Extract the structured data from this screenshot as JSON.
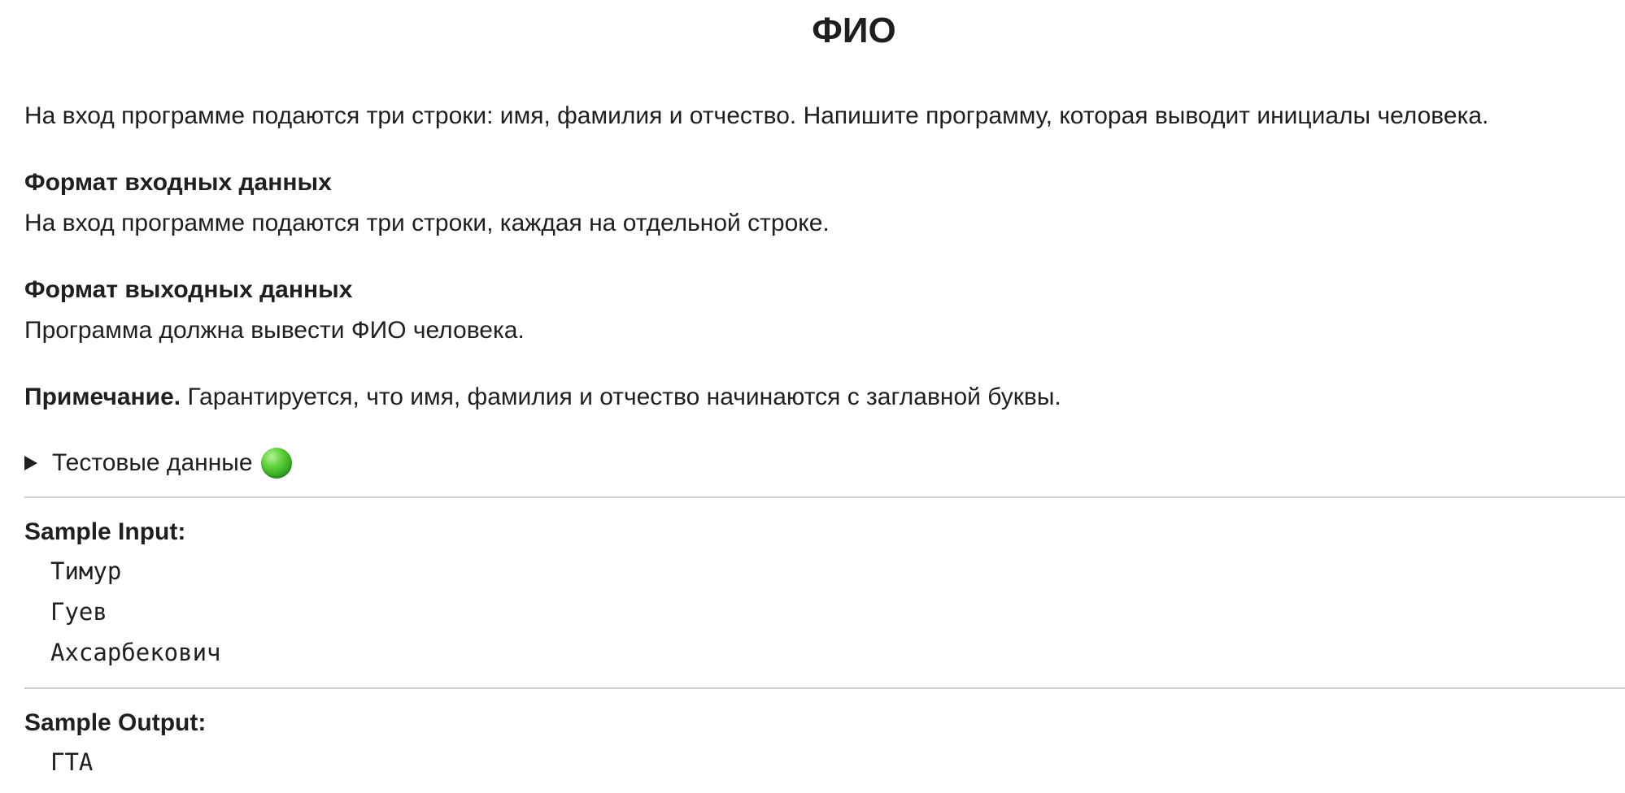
{
  "title": "ФИО",
  "intro": "На вход программе подаются три строки: имя, фамилия и отчество. Напишите программу, которая выводит инициалы человека.",
  "input_format": {
    "heading": "Формат входных данных",
    "text": "На вход программе подаются три строки, каждая на отдельной строке."
  },
  "output_format": {
    "heading": "Формат выходных данных",
    "text": "Программа должна вывести ФИО человека."
  },
  "note": {
    "label": "Примечание.",
    "text": " Гарантируется, что имя, фамилия и отчество начинаются с заглавной буквы."
  },
  "test_data": {
    "label": "Тестовые данные",
    "status_icon": "green-circle-icon",
    "status_color": "#3cbf2a"
  },
  "sample_input": {
    "label": "Sample Input:",
    "lines": [
      "Тимур",
      "Гуев",
      "Ахсарбекович"
    ]
  },
  "sample_output": {
    "label": "Sample Output:",
    "lines": [
      "ГТА"
    ]
  }
}
